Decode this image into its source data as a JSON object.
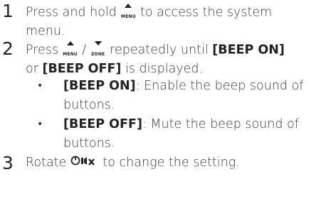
{
  "steps": [
    {
      "number": "1",
      "text_before_icon": "Press and hold ",
      "icon_label": "MENU",
      "text_after_icon": " to access the system",
      "line2": "menu."
    },
    {
      "number": "2",
      "text_before_icon": "Press ",
      "icon1_label": "MENU",
      "separator": " / ",
      "icon2_label": "ZONE",
      "text_mid": " repeatedly until ",
      "bold1": "[BEEP ON]",
      "line2_prefix": "or ",
      "bold2": "[BEEP OFF]",
      "line2_suffix": " is displayed.",
      "bullets": [
        {
          "bold": "[BEEP ON]",
          "text": ": Enable the beep sound of",
          "line2": "buttons."
        },
        {
          "bold": "[BEEP OFF]",
          "text": ": Mute the beep sound of",
          "line2": "buttons."
        }
      ]
    },
    {
      "number": "3",
      "text_before_icon": "Rotate ",
      "text_after_icon": " to change the setting."
    }
  ]
}
